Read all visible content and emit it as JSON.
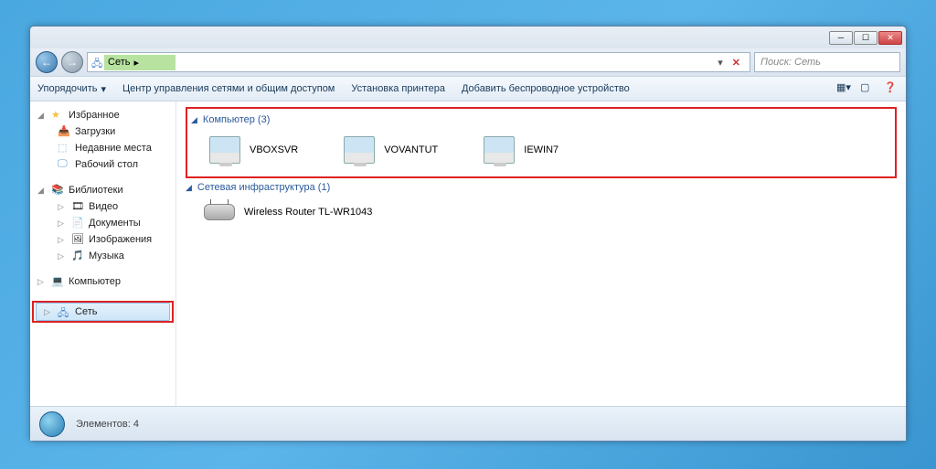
{
  "titlebar": {},
  "address": {
    "location": "Сеть",
    "placeholder": "Поиск: Сеть",
    "arrow": "▸"
  },
  "toolbar": {
    "organize": "Упорядочить",
    "network_center": "Центр управления сетями и общим доступом",
    "add_printer": "Установка принтера",
    "add_wireless": "Добавить беспроводное устройство"
  },
  "sidebar": {
    "favorites": {
      "label": "Избранное",
      "items": [
        "Загрузки",
        "Недавние места",
        "Рабочий стол"
      ]
    },
    "libraries": {
      "label": "Библиотеки",
      "items": [
        "Видео",
        "Документы",
        "Изображения",
        "Музыка"
      ]
    },
    "computer": {
      "label": "Компьютер"
    },
    "network": {
      "label": "Сеть"
    }
  },
  "content": {
    "computers": {
      "header": "Компьютер (3)",
      "items": [
        "VBOXSVR",
        "VOVANTUT",
        "IEWIN7"
      ]
    },
    "infra": {
      "header": "Сетевая инфраструктура (1)",
      "items": [
        "Wireless Router TL-WR1043"
      ]
    }
  },
  "status": {
    "elements": "Элементов: 4"
  }
}
